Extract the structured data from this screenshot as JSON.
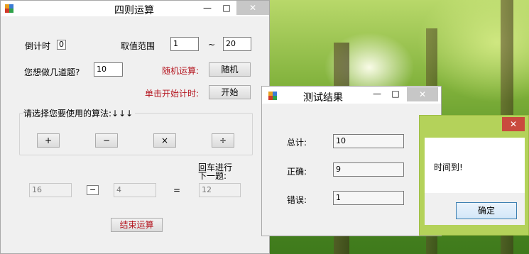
{
  "main": {
    "title": "四则运算",
    "minimize": "—",
    "maximize": "□",
    "close": "✕",
    "countdown_label": "倒计时",
    "countdown_value": "0",
    "range_label": "取值范围",
    "range_min": "1",
    "range_sep": "~",
    "range_max": "20",
    "count_label": "您想做几道题?",
    "count_value": "10",
    "random_label": "随机运算:",
    "random_button": "随机",
    "start_label": "单击开始计时:",
    "start_button": "开始",
    "op_group_label": "请选择您要使用的算法:↓↓↓",
    "op_plus": "+",
    "op_minus": "−",
    "op_times": "×",
    "op_divide": "÷",
    "enter_hint_1": "回车进行",
    "enter_hint_2": "下一题:",
    "operand1": "16",
    "operator": "−",
    "operand2": "4",
    "equals": "=",
    "answer": "12",
    "end_button": "结束运算"
  },
  "result": {
    "title": "测试结果",
    "minimize": "—",
    "maximize": "□",
    "close": "✕",
    "total_label": "总计:",
    "total_value": "10",
    "correct_label": "正确:",
    "correct_value": "9",
    "wrong_label": "错误:",
    "wrong_value": "1"
  },
  "dialog": {
    "close": "✕",
    "message": "时间到!",
    "ok": "确定"
  }
}
